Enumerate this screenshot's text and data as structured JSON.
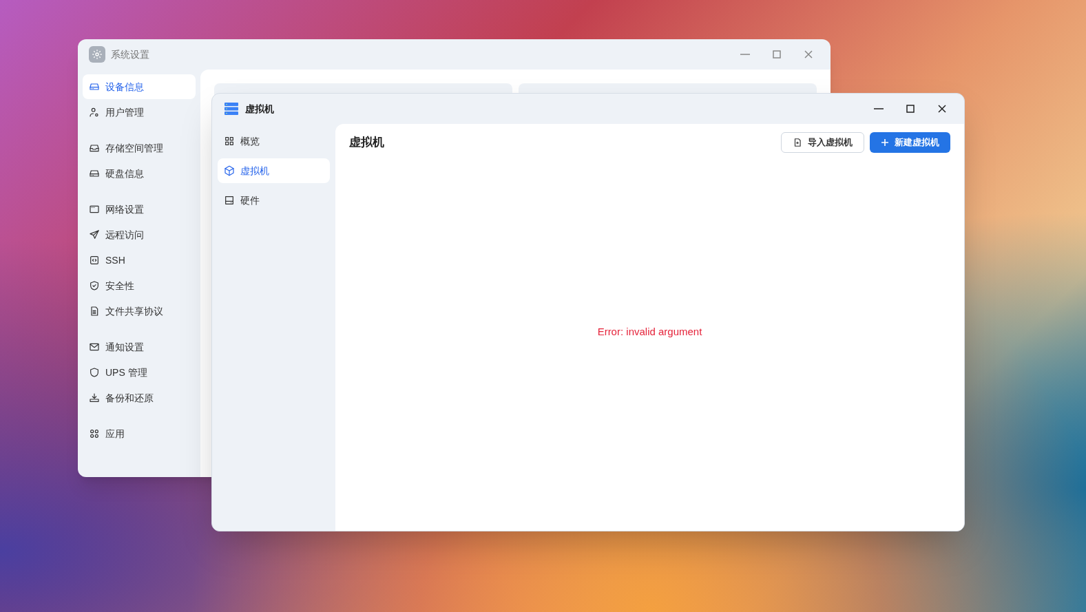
{
  "settings_window": {
    "title": "系统设置",
    "sidebar_groups": [
      [
        {
          "label": "设备信息",
          "selected": true
        },
        {
          "label": "用户管理",
          "selected": false
        }
      ],
      [
        {
          "label": "存储空间管理",
          "selected": false
        },
        {
          "label": "硬盘信息",
          "selected": false
        }
      ],
      [
        {
          "label": "网络设置",
          "selected": false
        },
        {
          "label": "远程访问",
          "selected": false
        },
        {
          "label": "SSH",
          "selected": false
        },
        {
          "label": "安全性",
          "selected": false
        },
        {
          "label": "文件共享协议",
          "selected": false
        }
      ],
      [
        {
          "label": "通知设置",
          "selected": false
        },
        {
          "label": "UPS 管理",
          "selected": false
        },
        {
          "label": "备份和还原",
          "selected": false
        }
      ],
      [
        {
          "label": "应用",
          "selected": false
        }
      ]
    ]
  },
  "vm_window": {
    "title": "虚拟机",
    "sidebar": [
      {
        "label": "概览",
        "selected": false
      },
      {
        "label": "虚拟机",
        "selected": true
      },
      {
        "label": "硬件",
        "selected": false
      }
    ],
    "heading": "虚拟机",
    "buttons": [
      {
        "kind": "secondary",
        "label": "导入虚拟机"
      },
      {
        "kind": "primary",
        "label": "新建虚拟机"
      }
    ],
    "error": "Error: invalid argument"
  }
}
